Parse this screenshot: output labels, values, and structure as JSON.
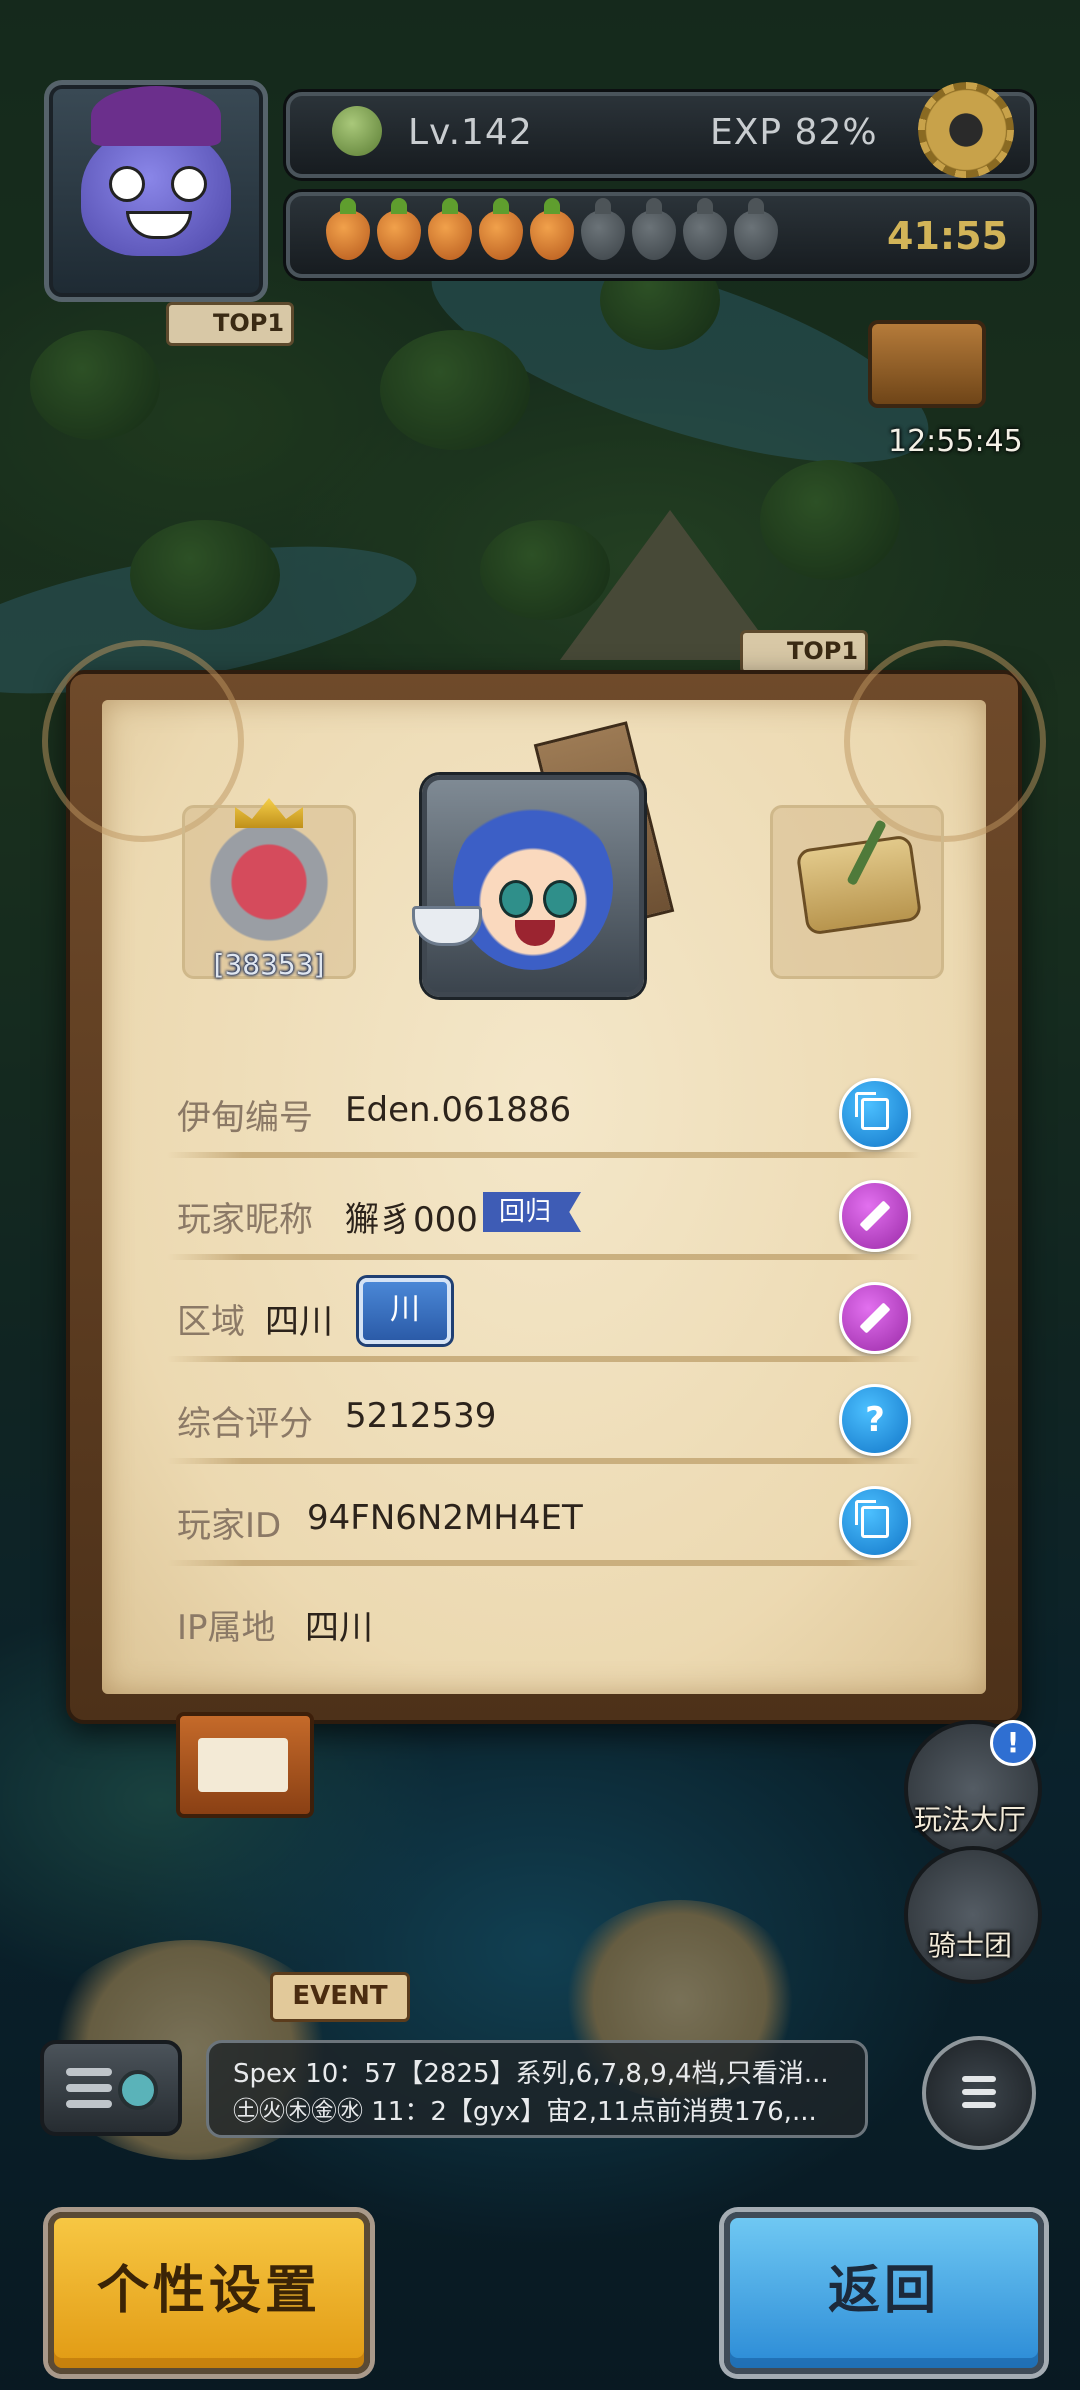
{
  "hud": {
    "level": "Lv.142",
    "exp": "EXP 82%",
    "stamina_full": 5,
    "stamina_max": 9,
    "stamina_timer": "41:55",
    "chest_timer": "12:55:45"
  },
  "map_badges": {
    "top1_a": "TOP1",
    "top1_b": "TOP1",
    "event": "EVENT"
  },
  "profile": {
    "guild_badge_number": "[38353]",
    "rows": {
      "eden_id": {
        "label": "伊甸编号",
        "value": "Eden.061886"
      },
      "nickname": {
        "label": "玩家昵称",
        "value": "獬豸000",
        "tag": "回归"
      },
      "region": {
        "label": "区域",
        "value": "四川",
        "tag": "川"
      },
      "score": {
        "label": "综合评分",
        "value": "5212539"
      },
      "player_id": {
        "label": "玩家ID",
        "value": "94FN6N2MH4ET"
      },
      "ip": {
        "label": "IP属地",
        "value": "四川"
      }
    },
    "icons": {
      "copy": "copy-icon",
      "edit": "pencil-icon",
      "help": "?"
    }
  },
  "side_menu": {
    "game_hall": "玩法大厅",
    "knights": "骑士团",
    "alert": "!"
  },
  "chat": {
    "line1": "Spex  10：57【2825】系列,6,7,8,9,4档,只看消...",
    "line2": "㊏㊋㊍㊎㊌  11：2【gyx】宙2,11点前消费176,..."
  },
  "buttons": {
    "settings": "个性设置",
    "back": "返回"
  }
}
